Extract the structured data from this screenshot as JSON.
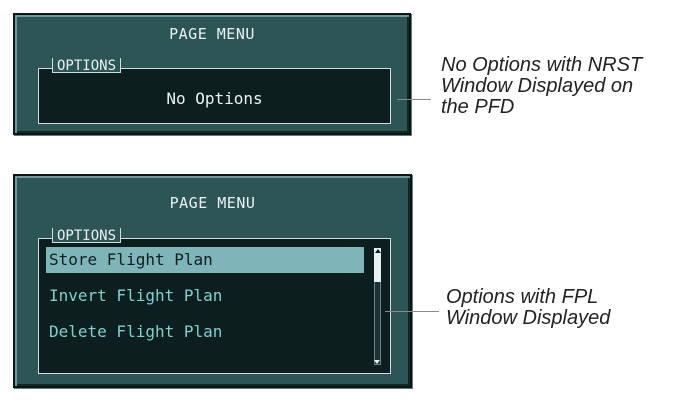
{
  "top_window": {
    "title": "PAGE MENU",
    "options_label": "OPTIONS",
    "message": "No Options"
  },
  "bottom_window": {
    "title": "PAGE MENU",
    "options_label": "OPTIONS",
    "options": [
      {
        "label": "Store Flight Plan",
        "selected": true
      },
      {
        "label": "Invert Flight Plan",
        "selected": false
      },
      {
        "label": "Delete Flight Plan",
        "selected": false
      }
    ],
    "scroll_position": 0.0
  },
  "callouts": {
    "top": [
      "No Options with NRST",
      "Window Displayed on",
      "the PFD"
    ],
    "bottom": [
      "Options with FPL",
      "Window Displayed"
    ]
  },
  "colors": {
    "window_bg": "#2d5556",
    "list_bg": "#0d1e1f",
    "option_text": "#7fd0cf",
    "selected_bg": "#7fb5b8",
    "header_text": "#e8f2f2"
  }
}
